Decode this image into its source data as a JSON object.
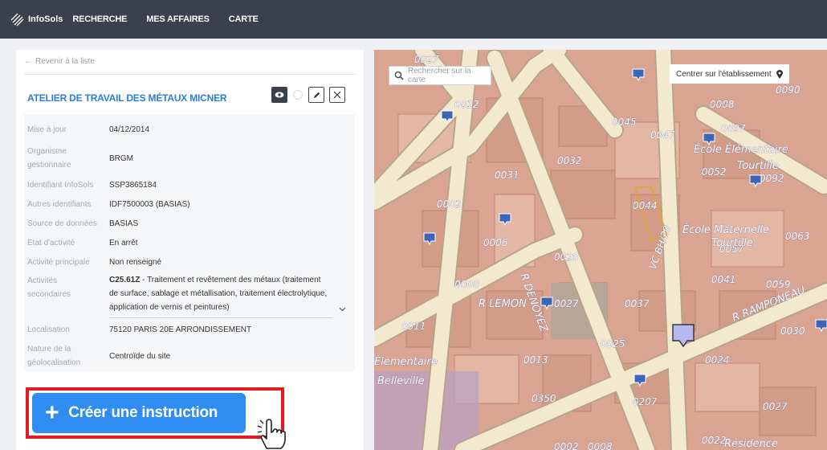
{
  "app": {
    "logo_text": "InfoSols"
  },
  "nav": {
    "items": [
      "RECHERCHE",
      "MES AFFAIRES",
      "CARTE"
    ]
  },
  "panel": {
    "back_label": "Revenir à la liste",
    "title": "ATELIER DE TRAVAIL DES MÉTAUX MICNER",
    "fields": {
      "maj": {
        "label": "Mise à jour",
        "value": "04/12/2014"
      },
      "org": {
        "label": "Organisme gestionnaire",
        "value": "BRGM"
      },
      "idinfo": {
        "label": "Identifiant InfoSols",
        "value": "SSP3865184"
      },
      "autres": {
        "label": "Autres identifiants",
        "value": "IDF7500003 (BASIAS)"
      },
      "source": {
        "label": "Source de données",
        "value": "BASIAS"
      },
      "etat": {
        "label": "Etat d'activité",
        "value": "En arrêt"
      },
      "princ": {
        "label": "Activité principale",
        "value": "Non renseigné"
      },
      "sec": {
        "label": "Activités secondaires",
        "code": "C25.61Z",
        "value": " - Traitement et revêtement des métaux (traitement de surface, sablage et métallisation, traitement électrolytique, application de vernis et peintures)"
      },
      "loc": {
        "label": "Localisation",
        "value": "75120 PARIS 20E ARRONDISSEMENT"
      },
      "geo": {
        "label": "Nature de la géolocalisation",
        "value": "Centroïde du site"
      }
    },
    "cta_label": "Créer une instruction"
  },
  "map": {
    "search_placeholder": "Rechercher sur la carte",
    "center_label": "Centrer sur l'établissement",
    "labels": [
      "0027",
      "0012",
      "0045",
      "0047",
      "0097",
      "0090",
      "0008",
      "0032",
      "0031",
      "0052",
      "0092",
      "0002",
      "0044",
      "0006",
      "0028",
      "0063",
      "0057",
      "0008",
      "R DENOYEZ",
      "R LEMON",
      "0027",
      "0037",
      "0041",
      "0059",
      "0011",
      "VC BH/20",
      "R RAMPONEAU",
      "0030",
      "0025",
      "0013",
      "0024",
      "0350",
      "0207",
      "0027",
      "0002",
      "0008",
      "0022",
      "Élementaire",
      "Belleville",
      "École Élémentaire",
      "Tourtille",
      "École Maternelle",
      "Tourtille",
      "Résidence"
    ],
    "colors": {
      "block": "#d9a592",
      "street": "#f3e9cf",
      "street_edge": "#b8a48b",
      "pin": "#3b66b8"
    }
  }
}
